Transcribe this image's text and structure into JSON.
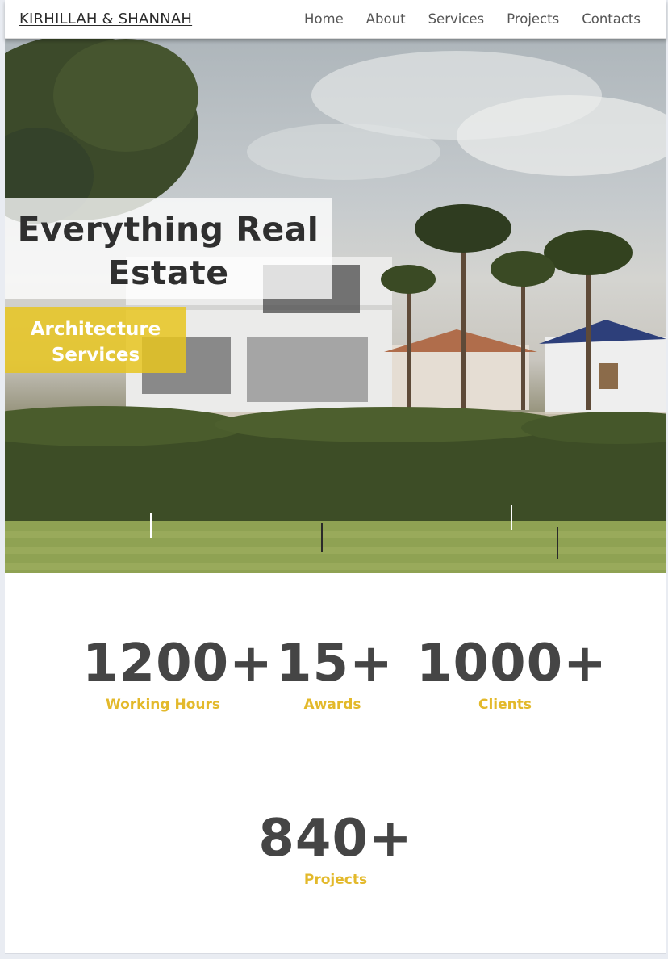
{
  "nav": {
    "brand": "KIRHILLAH & SHANNAH",
    "links": [
      "Home",
      "About",
      "Services",
      "Projects",
      "Contacts"
    ]
  },
  "hero": {
    "title_line1": "Everything Real",
    "title_line2": "Estate",
    "subtitle_line1": "Architecture",
    "subtitle_line2": "Services"
  },
  "stats": [
    {
      "number": "1200+",
      "label": "Working Hours"
    },
    {
      "number": "15+",
      "label": "Awards"
    },
    {
      "number": "1000+",
      "label": "Clients"
    },
    {
      "number": "840+",
      "label": "Projects"
    }
  ],
  "colors": {
    "accent": "#e3b92b",
    "text_dark": "#454545",
    "hero_sub_bg": "#e8c620"
  }
}
